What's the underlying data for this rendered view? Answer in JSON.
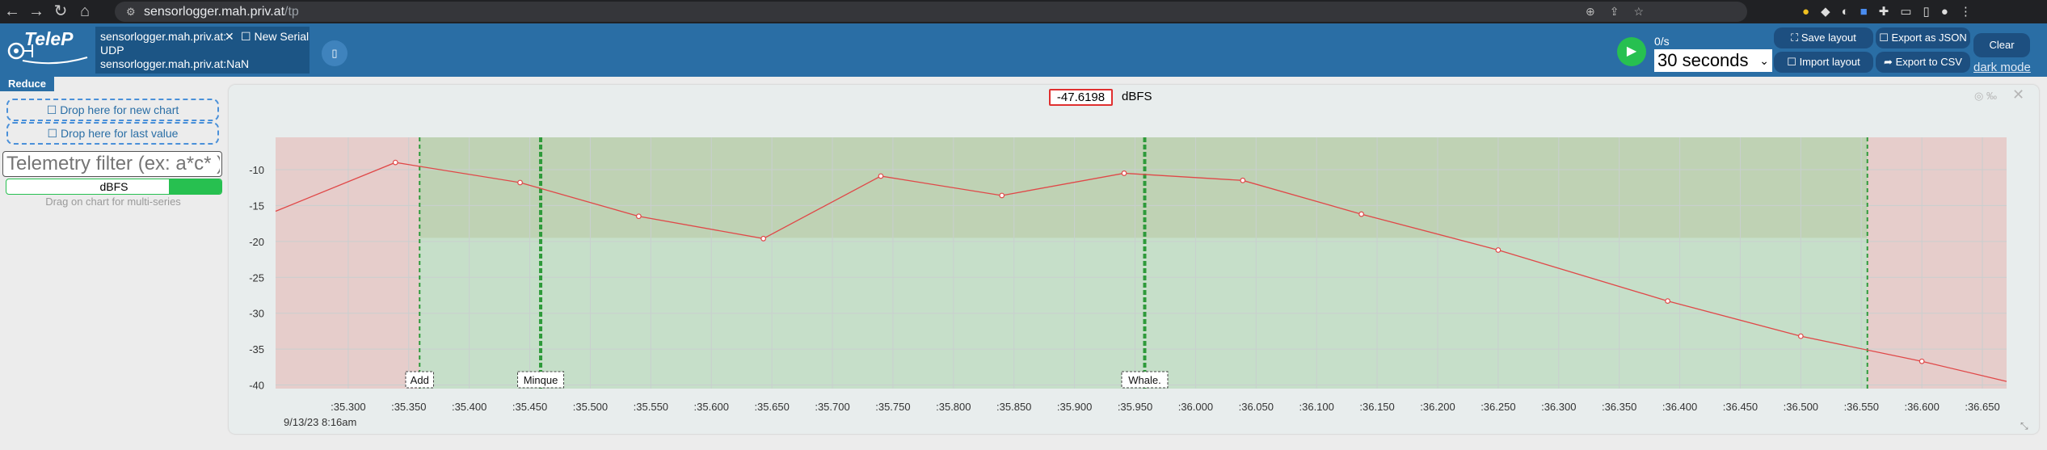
{
  "browser": {
    "url_host": "sensorlogger.mah.priv.at",
    "url_path": "/tp"
  },
  "header": {
    "logo_text": "TeleP",
    "connection": {
      "title": "sensorlogger.mah.priv.at:",
      "protocol": "UDP",
      "address": "sensorlogger.mah.priv.at:NaN"
    },
    "new_serial_label": "New Serial",
    "rate": "0/s",
    "time_window": "30 seconds",
    "save_layout": "Save layout",
    "import_layout": "Import layout",
    "export_json": "Export as JSON",
    "export_csv": "Export to CSV",
    "clear": "Clear",
    "dark_mode": "dark mode",
    "accent_color": "#2a6ea5",
    "play_color": "#27c050"
  },
  "sidebar": {
    "reduce_label": "Reduce",
    "drop_new_chart": "Drop here for new chart",
    "drop_last_value": "Drop here for last value",
    "filter_placeholder": "Telemetry filter (ex: a*c* )",
    "series": [
      "dBFS"
    ],
    "drag_hint": "Drag on chart for multi-series"
  },
  "chart": {
    "current_value": "-47.6198",
    "unit": "dBFS",
    "date_label": "9/13/23 8:16am"
  },
  "chart_data": {
    "type": "line",
    "series": [
      {
        "name": "dBFS",
        "x": [
          ":35.240",
          ":35.339",
          ":35.442",
          ":35.540",
          ":35.643",
          ":35.740",
          ":35.840",
          ":35.941",
          ":36.039",
          ":36.137",
          ":36.250",
          ":36.390",
          ":36.500",
          ":36.600",
          ":36.670"
        ],
        "values": [
          -15.8,
          -9.0,
          -11.8,
          -16.5,
          -19.6,
          -10.9,
          -13.6,
          -10.5,
          -11.5,
          -16.2,
          -21.2,
          -28.3,
          -33.2,
          -36.7,
          -39.5
        ],
        "color": "#e04848"
      }
    ],
    "x_ticks": [
      ":35.300",
      ":35.350",
      ":35.400",
      ":35.450",
      ":35.500",
      ":35.550",
      ":35.600",
      ":35.650",
      ":35.700",
      ":35.750",
      ":35.800",
      ":35.850",
      ":35.900",
      ":35.950",
      ":36.000",
      ":36.050",
      ":36.100",
      ":36.150",
      ":36.200",
      ":36.250",
      ":36.300",
      ":36.350",
      ":36.400",
      ":36.450",
      ":36.500",
      ":36.550",
      ":36.600",
      ":36.650"
    ],
    "y_ticks": [
      -10,
      -15,
      -20,
      -25,
      -30,
      -35,
      -40
    ],
    "ylim": [
      -40.5,
      -5.5
    ],
    "xlim": [
      ":35.240",
      ":36.670"
    ],
    "green_region": [
      ":35.359",
      ":36.555"
    ],
    "red_regions": [
      [
        ":35.240",
        ":35.359"
      ],
      [
        ":36.555",
        ":36.670"
      ]
    ],
    "markers": [
      {
        "label": "Add",
        "x": ":35.359",
        "style": "dashed-thin"
      },
      {
        "label": "Minque",
        "x": ":35.459",
        "style": "dashed-thick"
      },
      {
        "label": "Whale.",
        "x": ":35.958",
        "style": "dashed-thick"
      },
      {
        "label": "",
        "x": ":36.555",
        "style": "dashed-thin"
      }
    ],
    "grid": true
  }
}
